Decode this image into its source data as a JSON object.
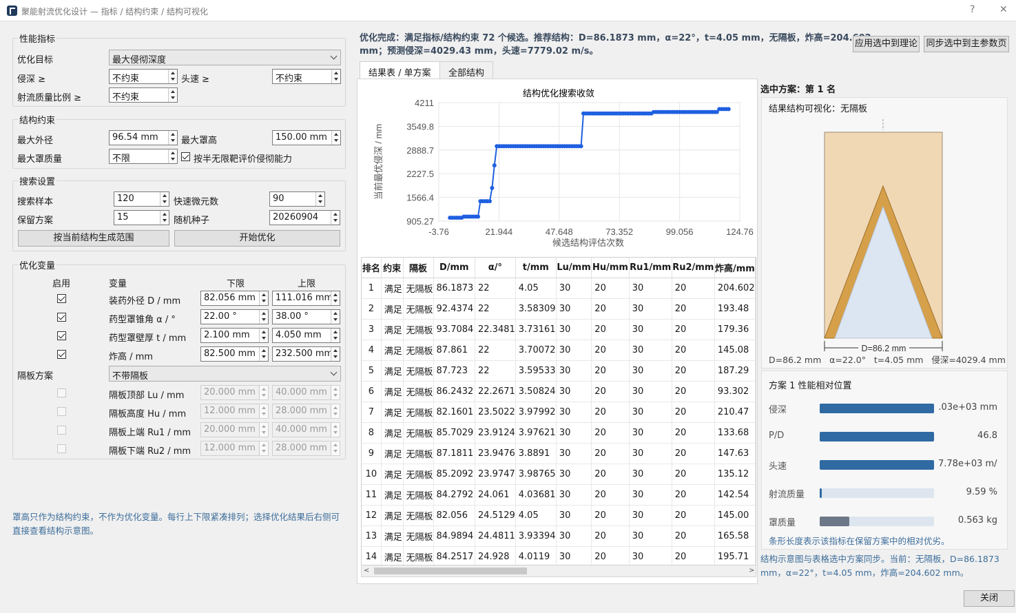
{
  "window": {
    "title": "聚能射流优化设计 — 指标 / 结构约束 / 结构可视化",
    "help": "?",
    "close": "✕"
  },
  "perf": {
    "group": "性能指标",
    "objective_label": "优化目标",
    "objective_value": "最大侵彻深度",
    "depth_label": "侵深 ≥",
    "depth_value": "不约束",
    "speed_label": "头速 ≥",
    "speed_value": "不约束",
    "ratio_label": "射流质量比例 ≥",
    "ratio_value": "不约束"
  },
  "struct": {
    "group": "结构约束",
    "od_label": "最大外径",
    "od_value": "96.54 mm",
    "h_label": "最大罩高",
    "h_value": "150.00 mm",
    "mass_label": "最大罩质量",
    "mass_value": "不限",
    "semi_label": "按半无限靶评价侵彻能力"
  },
  "search": {
    "group": "搜索设置",
    "samples_label": "搜索样本",
    "samples_value": "120",
    "fast_label": "快速微元数",
    "fast_value": "90",
    "keep_label": "保留方案",
    "keep_value": "15",
    "seed_label": "随机种子",
    "seed_value": "20260904",
    "gen_btn": "按当前结构生成范围",
    "start_btn": "开始优化"
  },
  "vars": {
    "group": "优化变量",
    "col_enable": "启用",
    "col_var": "变量",
    "col_low": "下限",
    "col_high": "上限",
    "rows": [
      {
        "name": "装药外径 D / mm",
        "low": "82.056 mm",
        "high": "111.016 mm"
      },
      {
        "name": "药型罩锥角 α / °",
        "low": "22.00 °",
        "high": "38.00 °"
      },
      {
        "name": "药型罩壁厚 t / mm",
        "low": "2.100 mm",
        "high": "4.050 mm"
      },
      {
        "name": "炸高 / mm",
        "low": "82.500 mm",
        "high": "232.500 mm"
      }
    ],
    "baffle_label": "隔板方案",
    "baffle_value": "不带隔板",
    "baffle_rows": [
      {
        "name": "隔板顶部 Lu / mm",
        "low": "20.000 mm",
        "high": "40.000 mm"
      },
      {
        "name": "隔板高度 Hu / mm",
        "low": "12.000 mm",
        "high": "28.000 mm"
      },
      {
        "name": "隔板上端 Ru1 / mm",
        "low": "20.000 mm",
        "high": "40.000 mm"
      },
      {
        "name": "隔板下端 Ru2 / mm",
        "low": "12.000 mm",
        "high": "28.000 mm"
      }
    ]
  },
  "left_note": "罩高只作为结构约束，不作为优化变量。每行上下限紧凑排列；选择优化结果后右侧可直接查看结构示意图。",
  "summary": {
    "line1": "优化完成：满足指标/结构约束 72 个候选。推荐结构：D=86.1873 mm，α=22°，t=4.05 mm，无隔板，炸高=204.602",
    "line2": "mm；预测侵深=4029.43 mm，头速=7779.02 m/s。",
    "apply_btn": "应用选中到理论",
    "sync_btn": "同步选中到主参数页"
  },
  "tabs": {
    "t1": "结果表 / 单方案",
    "t2": "全部结构"
  },
  "chart_data": {
    "type": "line",
    "title": "结构优化搜索收敛",
    "xlabel": "候选结构评估次数",
    "ylabel": "当前最优侵深 / mm",
    "xticks": [
      "-3.76",
      "21.944",
      "47.648",
      "73.352",
      "99.056",
      "124.76"
    ],
    "yticks": [
      "905.27",
      "1566.4",
      "2227.5",
      "2888.7",
      "3549.8",
      "4211"
    ],
    "xlim": [
      -3.76,
      124.76
    ],
    "ylim": [
      905.27,
      4211
    ],
    "color": "#1f5fe0",
    "segments": [
      {
        "from": 1,
        "to": 6,
        "y": 1000
      },
      {
        "from": 7,
        "to": 13,
        "y": 1030
      },
      {
        "from": 14,
        "to": 18,
        "y": 1460
      },
      {
        "from": 19,
        "to": 19,
        "y": 1830
      },
      {
        "from": 20,
        "to": 20,
        "y": 2460
      },
      {
        "from": 21,
        "to": 57,
        "y": 2995
      },
      {
        "from": 58,
        "to": 87,
        "y": 3910
      },
      {
        "from": 88,
        "to": 115,
        "y": 3950
      },
      {
        "from": 116,
        "to": 120,
        "y": 4030
      }
    ]
  },
  "table": {
    "headers": [
      "排名",
      "约束",
      "隔板",
      "D/mm",
      "α/°",
      "t/mm",
      "Lu/mm",
      "Hu/mm",
      "Ru1/mm",
      "Ru2/mm",
      "炸高/mm"
    ],
    "rows": [
      [
        "1",
        "满足",
        "无隔板",
        "86.1873",
        "22",
        "4.05",
        "30",
        "20",
        "30",
        "20",
        "204.602"
      ],
      [
        "2",
        "满足",
        "无隔板",
        "92.4374",
        "22",
        "3.58309",
        "30",
        "20",
        "30",
        "20",
        "193.48"
      ],
      [
        "3",
        "满足",
        "无隔板",
        "93.7084",
        "22.3481",
        "3.73161",
        "30",
        "20",
        "30",
        "20",
        "179.36"
      ],
      [
        "4",
        "满足",
        "无隔板",
        "87.861",
        "22",
        "3.70072",
        "30",
        "20",
        "30",
        "20",
        "145.08"
      ],
      [
        "5",
        "满足",
        "无隔板",
        "87.723",
        "22",
        "3.59533",
        "30",
        "20",
        "30",
        "20",
        "187.29"
      ],
      [
        "6",
        "满足",
        "无隔板",
        "86.2432",
        "22.2671",
        "3.50824",
        "30",
        "20",
        "30",
        "20",
        "93.302"
      ],
      [
        "7",
        "满足",
        "无隔板",
        "82.1601",
        "23.5022",
        "3.97992",
        "30",
        "20",
        "30",
        "20",
        "210.47"
      ],
      [
        "8",
        "满足",
        "无隔板",
        "85.7029",
        "23.9124",
        "3.97621",
        "30",
        "20",
        "30",
        "20",
        "133.68"
      ],
      [
        "9",
        "满足",
        "无隔板",
        "87.1811",
        "23.9476",
        "3.8891",
        "30",
        "20",
        "30",
        "20",
        "147.63"
      ],
      [
        "10",
        "满足",
        "无隔板",
        "85.2092",
        "23.9747",
        "3.98765",
        "30",
        "20",
        "30",
        "20",
        "135.12"
      ],
      [
        "11",
        "满足",
        "无隔板",
        "84.2792",
        "24.061",
        "4.03681",
        "30",
        "20",
        "30",
        "20",
        "142.54"
      ],
      [
        "12",
        "满足",
        "无隔板",
        "82.056",
        "24.5129",
        "4.05",
        "30",
        "20",
        "30",
        "20",
        "145.00"
      ],
      [
        "13",
        "满足",
        "无隔板",
        "84.9894",
        "24.4811",
        "3.93394",
        "30",
        "20",
        "30",
        "20",
        "165.58"
      ],
      [
        "14",
        "满足",
        "无隔板",
        "84.2517",
        "24.928",
        "4.0119",
        "30",
        "20",
        "30",
        "20",
        "195.71"
      ]
    ]
  },
  "selected": {
    "header": "选中方案：第 1 名",
    "vis_title": "结果结构可视化：无隔板",
    "dim_label": "D=86.2 mm",
    "caption": "D=86.2 mm   α=22.0°   t=4.05 mm   侵深=4029.4 mm",
    "perf_title": "方案 1 性能相对位置",
    "bars": [
      {
        "name": "侵深",
        "value": ".03e+03 mm",
        "fraction": 1.0,
        "color": "#2f6aa3"
      },
      {
        "name": "P/D",
        "value": "46.8",
        "fraction": 1.0,
        "color": "#2f6aa3"
      },
      {
        "name": "头速",
        "value": "7.78e+03 m/s",
        "fraction": 1.0,
        "color": "#2f6aa3"
      },
      {
        "name": "射流质量",
        "value": "9.59 %",
        "fraction": 0.02,
        "color": "#2f6aa3"
      },
      {
        "name": "罩质量",
        "value": "0.563 kg",
        "fraction": 0.26,
        "color": "#6c7787"
      }
    ],
    "bar_note": "条形长度表示该指标在保留方案中的相对优劣。",
    "sync_note": "结构示意图与表格选中方案同步。当前：无隔板，D=86.1873 mm，α=22°，t=4.05 mm，炸高=204.602 mm。"
  },
  "close_btn": "关闭"
}
